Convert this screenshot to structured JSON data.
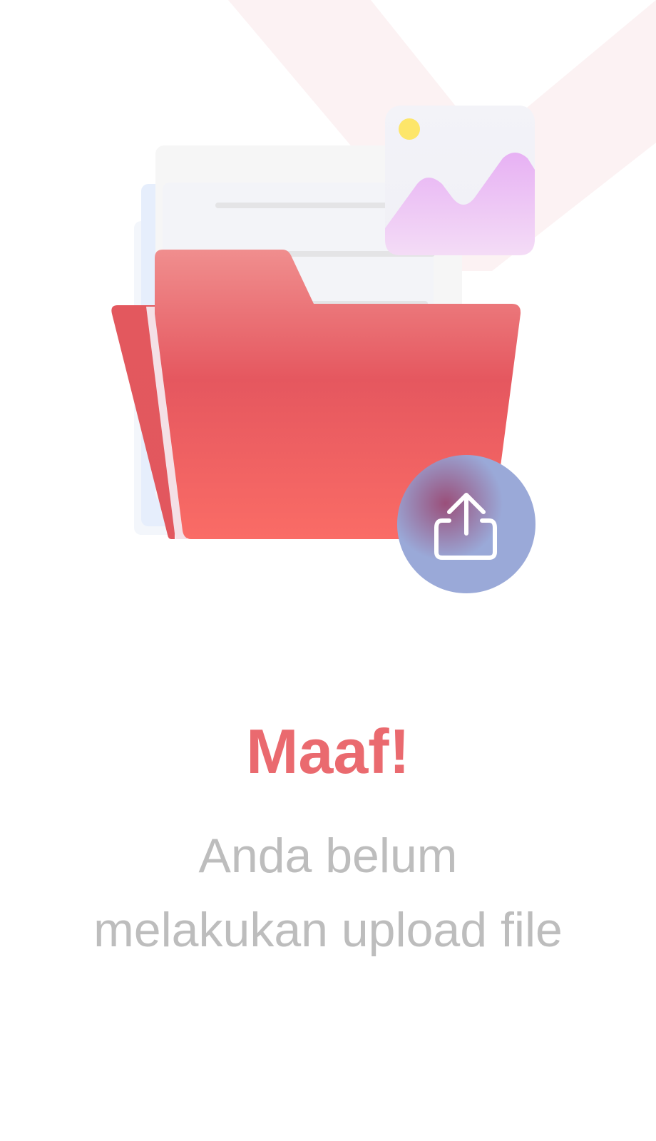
{
  "empty_state": {
    "title": "Maaf!",
    "message_line1": "Anda belum",
    "message_line2": "melakukan upload file"
  },
  "illustration": {
    "folder_icon": "open-folder-icon",
    "image_icon": "image-thumbnail-icon",
    "upload_icon": "upload-share-icon"
  },
  "colors": {
    "title": "#ea6a6f",
    "message": "#bdbdbd",
    "folder": "#e85a62",
    "upload_badge": "#9aa9d8"
  }
}
